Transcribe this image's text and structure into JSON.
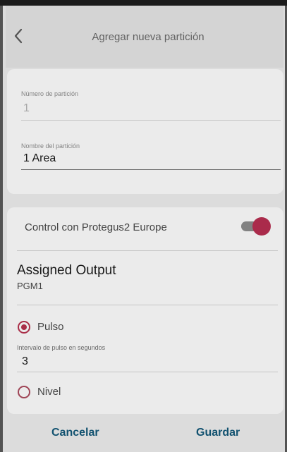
{
  "header": {
    "title": "Agregar nueva partición"
  },
  "partition": {
    "number_label": "Número de partición",
    "number_value": "1",
    "name_label": "Nombre del partición",
    "name_value": "1 Area"
  },
  "control": {
    "label": "Control con Protegus2 Europe",
    "enabled": true
  },
  "assigned_output": {
    "title": "Assigned Output",
    "value": "PGM1"
  },
  "mode": {
    "pulse_label": "Pulso",
    "pulse_selected": true,
    "interval_label": "Intervalo de pulso en segundos",
    "interval_value": "3",
    "level_label": "Nivel",
    "level_selected": false
  },
  "actions": {
    "cancel_label": "Cancelar",
    "save_label": "Guardar"
  },
  "colors": {
    "accent": "#b8324f",
    "action": "#14597a"
  }
}
